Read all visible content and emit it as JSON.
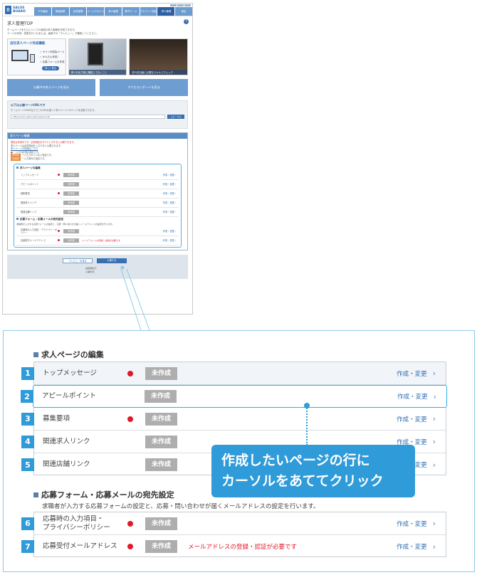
{
  "mini": {
    "logo": {
      "line1": "SALOS",
      "line2": "BOARD"
    },
    "nav": [
      "TOP画面",
      "検索結果",
      "会員管理",
      "メールマガジン",
      "求人管理",
      "電子ゲージ",
      "アカウント設定",
      "求人管理",
      "設定"
    ],
    "title": "求人管理TOP",
    "lead1": "ホームページをもとにシンプル構成の求人原稿を作成できます。",
    "lead2": "ページの作成・変更を行ったあとは、画面下の「プレビュー」で確認してください。",
    "banner1": {
      "title": "自社求人ページ作成機能",
      "items": [
        "サイン作成会ページ",
        "かんたん作成！",
        "応募フォームも作成"
      ],
      "button": "詳しく見る"
    },
    "banner2_caption": "求人を出す前に確認しておくこと",
    "banner3_caption": "求人担当者に必要なスキルとチェック",
    "bigbtn1": "公開中の求人ページを見る",
    "bigbtn2": "アクセスレポートを見る",
    "url_box": {
      "heading": "以下は公開ページURLです",
      "text": "ホームページやSNSなどでこのURLを使って求人ページへのリンクを設置できます。",
      "url": "http://xxxxx.salos-board.jp/recruit/",
      "copy": "コピーする"
    },
    "panel": {
      "heading": "求人ページ編集",
      "notice": "現在は作成中です。必須項目をすべて入力すると公開できます。",
      "text1": "求人ページは必須項目を入力すると公開されます。",
      "link": "求人ページの詳細はこちら",
      "req": "一入力が必須の項目です。",
      "tag1": "未作成",
      "tag1_text": "一入力されていない項目です。",
      "tag2": "作成済",
      "tag2_text": "一入力済みの項目です。",
      "edit_title": "求人ページの編集",
      "form_title": "応募フォーム・応募メールの宛先設定",
      "form_note": "求職者が入力する応募フォームの設定と、応募・問い合わせが届くメールアドレスの設定を行います。"
    },
    "rows": [
      {
        "name": "トップメッセージ",
        "required": true,
        "status": "未作成",
        "warn": "",
        "action": "作成・変更"
      },
      {
        "name": "アピールポイント",
        "required": false,
        "status": "未作成",
        "warn": "",
        "action": "作成・変更"
      },
      {
        "name": "募集要項",
        "required": true,
        "status": "未作成",
        "warn": "",
        "action": "作成・変更"
      },
      {
        "name": "関連求人リンク",
        "required": false,
        "status": "未作成",
        "warn": "",
        "action": "作成・変更"
      },
      {
        "name": "関連店舗リンク",
        "required": false,
        "status": "未作成",
        "warn": "",
        "action": "作成・変更"
      }
    ],
    "form_rows": [
      {
        "name": "応募時の入力項目・プライバシーポリシー",
        "required": true,
        "status": "未作成",
        "warn": "",
        "action": "作成・変更"
      },
      {
        "name": "応募受付メールアドレス",
        "required": true,
        "status": "未作成",
        "warn": "メールアドレスの登録・認証が必要です",
        "action": "作成・変更"
      }
    ],
    "footer": {
      "preview": "プレビューを見る",
      "publish": "公開する",
      "note1": "最終更新日：",
      "note2": "公開状況："
    }
  },
  "zoom": {
    "section1": "求人ページの編集",
    "rows": [
      {
        "num": "1",
        "name": "トップメッセージ",
        "required": true,
        "status": "未作成",
        "warn": "",
        "action": "作成・変更"
      },
      {
        "num": "2",
        "name": "アピールポイント",
        "required": false,
        "status": "未作成",
        "warn": "",
        "action": "作成・変更"
      },
      {
        "num": "3",
        "name": "募集要項",
        "required": true,
        "status": "未作成",
        "warn": "",
        "action": "作成・変更"
      },
      {
        "num": "4",
        "name": "関連求人リンク",
        "required": false,
        "status": "未作成",
        "warn": "",
        "action": "作成・変更"
      },
      {
        "num": "5",
        "name": "関連店舗リンク",
        "required": false,
        "status": "未作成",
        "warn": "",
        "action": "作成・変更"
      }
    ],
    "section2": "応募フォーム・応募メールの宛先設定",
    "section2_desc": "求職者が入力する応募フォームの設定と、応募・問い合わせが届くメールアドレスの設定を行います。",
    "form_rows": [
      {
        "num": "6",
        "name_l1": "応募時の入力項目・",
        "name_l2": "プライバシーポリシー",
        "required": true,
        "status": "未作成",
        "warn": "",
        "action": "作成・変更"
      },
      {
        "num": "7",
        "name_l1": "応募受付メールアドレス",
        "name_l2": "",
        "required": true,
        "status": "未作成",
        "warn": "メールアドレスの登録・認証が必要です",
        "action": "作成・変更"
      }
    ],
    "callout_l1": "作成したいページの行に",
    "callout_l2": "カーソルをあててクリック"
  },
  "colors": {
    "accent": "#2f9bd9",
    "required_dot": "#e0192b",
    "status_bg": "#aeaeae",
    "link": "#2f6db0"
  }
}
